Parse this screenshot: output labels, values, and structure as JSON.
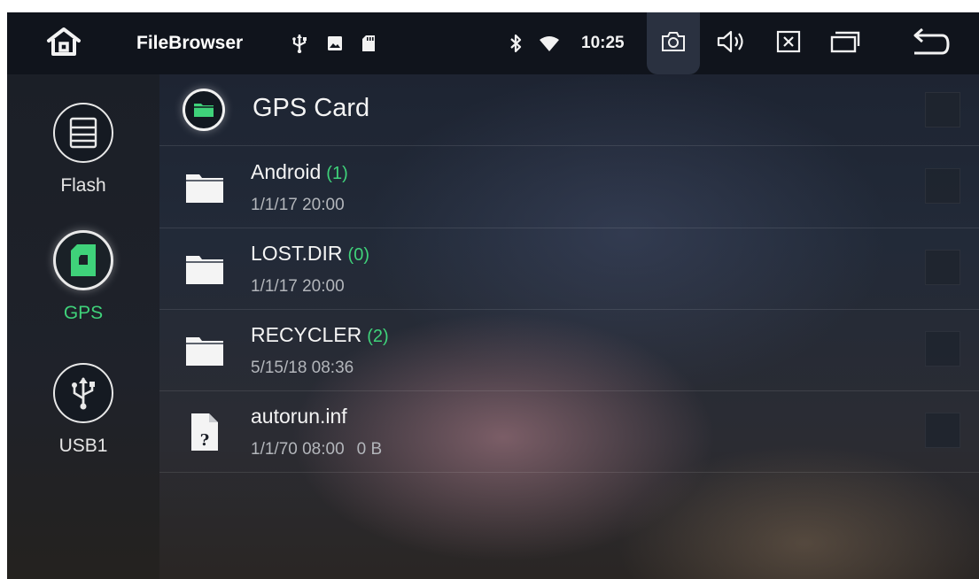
{
  "status_bar": {
    "app_title": "FileBrowser",
    "time": "10:25",
    "icons": [
      "home-icon",
      "usb-icon",
      "image-icon",
      "sd-card-icon",
      "bluetooth-icon",
      "wifi-icon",
      "camera-icon",
      "volume-icon",
      "close-icon",
      "window-icon",
      "back-icon"
    ]
  },
  "sidebar": {
    "sources": [
      {
        "label": "Flash",
        "icon": "storage-icon",
        "active": false
      },
      {
        "label": "GPS",
        "icon": "sd-card-icon",
        "active": true
      },
      {
        "label": "USB1",
        "icon": "usb-icon",
        "active": false
      }
    ]
  },
  "list": {
    "header": {
      "title": "GPS Card",
      "icon": "folder-icon"
    },
    "items": [
      {
        "name": "Android",
        "count": "(1)",
        "date": "1/1/17 20:00",
        "size": "",
        "type": "folder"
      },
      {
        "name": "LOST.DIR",
        "count": "(0)",
        "date": "1/1/17 20:00",
        "size": "",
        "type": "folder"
      },
      {
        "name": "RECYCLER",
        "count": "(2)",
        "date": "5/15/18 08:36",
        "size": "",
        "type": "folder"
      },
      {
        "name": "autorun.inf",
        "count": "",
        "date": "1/1/70 08:00",
        "size": "0 B",
        "type": "file"
      }
    ]
  },
  "colors": {
    "accent": "#3fd27a",
    "status_bar": "#10141c",
    "sidebar": "#1b1f27",
    "text": "#f4f4f4",
    "meta_text": "#b3b6bb"
  }
}
